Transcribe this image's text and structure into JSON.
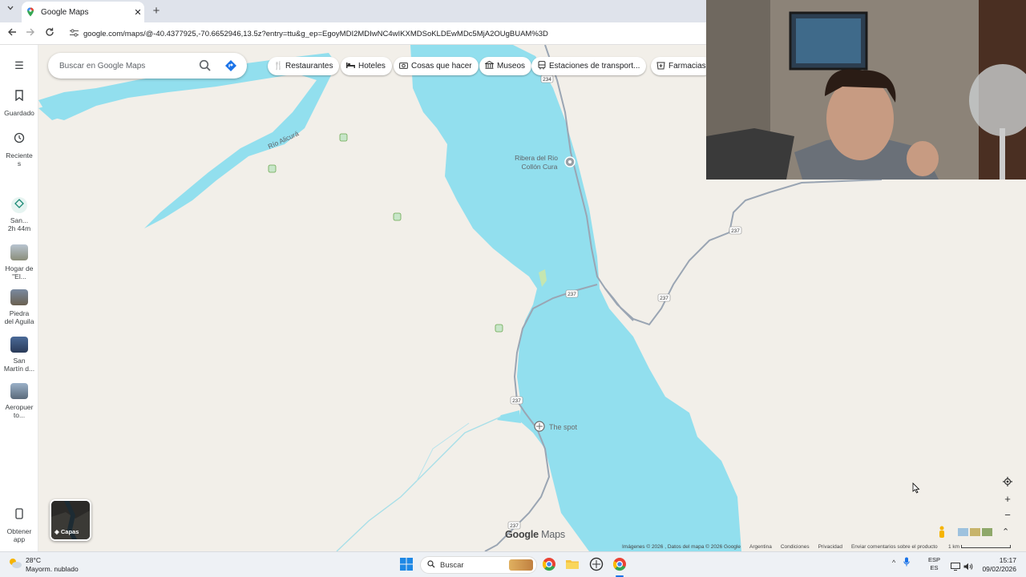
{
  "browser": {
    "tab_title": "Google Maps",
    "tab_close": "✕",
    "new_tab": "+",
    "url": "google.com/maps/@-40.4377925,-70.6652946,13.5z?entry=ttu&g_ep=EgoyMDI2MDIwNC4wIKXMDSoKLDEwMDc5MjA2OUgBUAM%3D"
  },
  "search": {
    "placeholder": "Buscar en Google Maps"
  },
  "chips": [
    {
      "label": "Restaurantes",
      "icon": "fork-knife-icon"
    },
    {
      "label": "Hoteles",
      "icon": "bed-icon"
    },
    {
      "label": "Cosas que hacer",
      "icon": "camera-icon"
    },
    {
      "label": "Museos",
      "icon": "museum-icon"
    },
    {
      "label": "Estaciones de transport...",
      "icon": "transit-icon"
    },
    {
      "label": "Farmacias",
      "icon": "pharmacy-icon"
    }
  ],
  "rail": {
    "saved": "Guardado",
    "recent_line1": "Reciente",
    "recent_line2": "s",
    "directions_line1": "San...",
    "directions_line2": "2h 44m",
    "places": [
      {
        "line1": "Hogar de",
        "line2": "\"El..."
      },
      {
        "line1": "Piedra",
        "line2": "del Aguila"
      },
      {
        "line1": "San",
        "line2": "Martín d..."
      },
      {
        "line1": "Aeropuer",
        "line2": "to..."
      }
    ],
    "get_app_line1": "Obtener",
    "get_app_line2": "app"
  },
  "map": {
    "river_label": "Río Alicurá",
    "place_label_1a": "Ribera del Rio",
    "place_label_1b": "Collón Cura",
    "poi_label": "The spot",
    "route_237": "237",
    "route_234": "234",
    "layers_label": "Capas",
    "brand_google": "Google",
    "brand_maps": " Maps",
    "attribution": [
      "Imágenes © 2026 , Datos del mapa © 2026 Google",
      "Argentina",
      "Condiciones",
      "Privacidad",
      "Enviar comentarios sobre el producto"
    ],
    "scale": "1 km",
    "zoom_in": "+",
    "zoom_out": "−",
    "colors": {
      "water": "#92dfee",
      "land": "#f2efe9",
      "road": "#9aa5b3",
      "park": "#8bc34a"
    }
  },
  "taskbar": {
    "temp": "28°C",
    "weather": "Mayorm. nublado",
    "search": "Buscar",
    "lang_line1": "ESP",
    "lang_line2": "ES",
    "time": "15:17",
    "date": "09/02/2026"
  }
}
